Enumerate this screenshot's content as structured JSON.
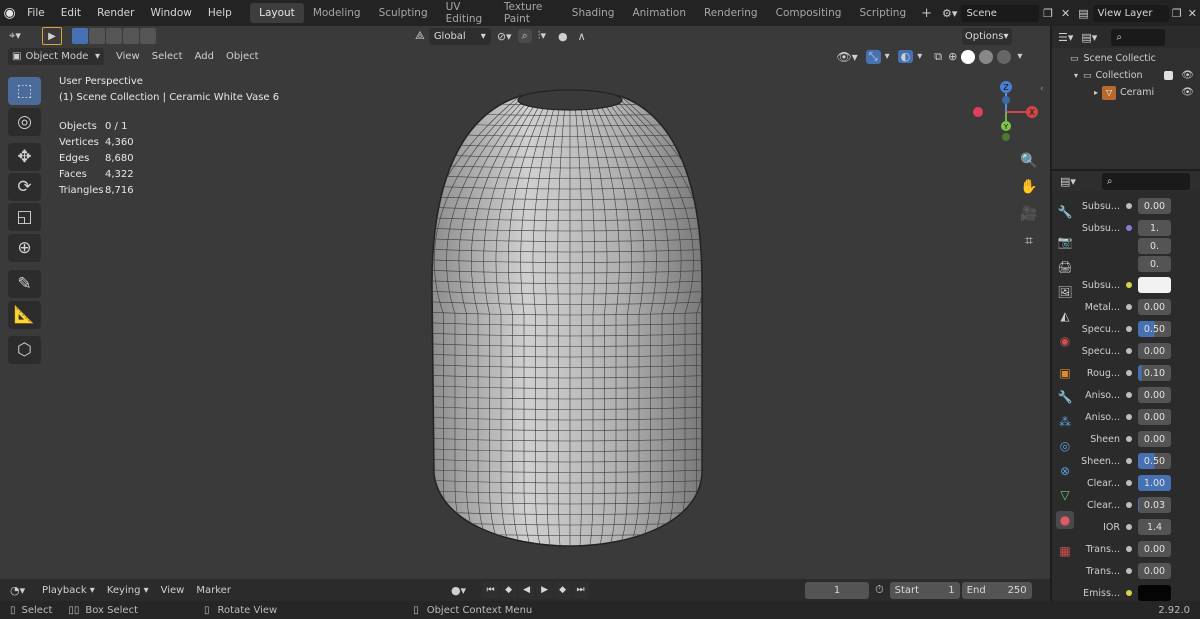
{
  "topbar": {
    "menus": [
      "File",
      "Edit",
      "Render",
      "Window",
      "Help"
    ],
    "workspaces": [
      "Layout",
      "Modeling",
      "Sculpting",
      "UV Editing",
      "Texture Paint",
      "Shading",
      "Animation",
      "Rendering",
      "Compositing",
      "Scripting"
    ],
    "active_workspace": "Layout",
    "scene": "Scene",
    "view_layer": "View Layer"
  },
  "viewport": {
    "orientation": "Global",
    "options_label": "Options",
    "mode": "Object Mode",
    "header_menus": [
      "View",
      "Select",
      "Add",
      "Object"
    ],
    "perspective": "User Perspective",
    "collection_info": "(1) Scene Collection | Ceramic White Vase 6",
    "stats": [
      {
        "label": "Objects",
        "value": "0 / 1"
      },
      {
        "label": "Vertices",
        "value": "4,360"
      },
      {
        "label": "Edges",
        "value": "8,680"
      },
      {
        "label": "Faces",
        "value": "4,322"
      },
      {
        "label": "Triangles",
        "value": "8,716"
      }
    ],
    "gizmo": {
      "z": "Z",
      "x": "X",
      "y": "Y"
    }
  },
  "outliner": {
    "root": "Scene Collectic",
    "collection": "Collection",
    "object": "Cerami"
  },
  "properties": {
    "rows": [
      {
        "label": "Subsu...",
        "values": [
          "0.00"
        ],
        "dot": "#bdbdbd",
        "style": "num"
      },
      {
        "label": "Subsu...",
        "values": [
          "1.",
          "0.",
          "0."
        ],
        "dot": "#8a7ad8",
        "style": "vec"
      },
      {
        "label": "Subsu...",
        "values": [
          ""
        ],
        "dot": "#d4d44a",
        "style": "color-white"
      },
      {
        "label": "Metal...",
        "values": [
          "0.00"
        ],
        "dot": "#bdbdbd",
        "style": "num"
      },
      {
        "label": "Specu...",
        "values": [
          "0.50"
        ],
        "dot": "#bdbdbd",
        "style": "num",
        "fill": 0.5
      },
      {
        "label": "Specu...",
        "values": [
          "0.00"
        ],
        "dot": "#bdbdbd",
        "style": "num"
      },
      {
        "label": "Roug...",
        "values": [
          "0.10"
        ],
        "dot": "#bdbdbd",
        "style": "num",
        "fill": 0.1
      },
      {
        "label": "Aniso...",
        "values": [
          "0.00"
        ],
        "dot": "#bdbdbd",
        "style": "num"
      },
      {
        "label": "Aniso...",
        "values": [
          "0.00"
        ],
        "dot": "#bdbdbd",
        "style": "num"
      },
      {
        "label": "Sheen",
        "values": [
          "0.00"
        ],
        "dot": "#bdbdbd",
        "style": "num"
      },
      {
        "label": "Sheen...",
        "values": [
          "0.50"
        ],
        "dot": "#bdbdbd",
        "style": "num",
        "fill": 0.5
      },
      {
        "label": "Clear...",
        "values": [
          "1.00"
        ],
        "dot": "#bdbdbd",
        "style": "num",
        "fill": 1.0
      },
      {
        "label": "Clear...",
        "values": [
          "0.03"
        ],
        "dot": "#bdbdbd",
        "style": "num",
        "fill": 0.03
      },
      {
        "label": "IOR",
        "values": [
          "1.4"
        ],
        "dot": "#bdbdbd",
        "style": "num"
      },
      {
        "label": "Trans...",
        "values": [
          "0.00"
        ],
        "dot": "#bdbdbd",
        "style": "num"
      },
      {
        "label": "Trans...",
        "values": [
          "0.00"
        ],
        "dot": "#bdbdbd",
        "style": "num"
      },
      {
        "label": "Emiss...",
        "values": [
          ""
        ],
        "dot": "#d4d44a",
        "style": "color-black"
      }
    ]
  },
  "timeline": {
    "menus": [
      "Playback",
      "Keying",
      "View",
      "Marker"
    ],
    "current_frame": "1",
    "start_label": "Start",
    "start_value": "1",
    "end_label": "End",
    "end_value": "250"
  },
  "statusbar": {
    "select": "Select",
    "box_select": "Box Select",
    "rotate_view": "Rotate View",
    "context_menu": "Object Context Menu",
    "version": "2.92.0"
  },
  "colors": {
    "accent": "#4672b4",
    "viewport_bg": "#3a3a3a",
    "panel_bg": "#2b2b2b"
  }
}
